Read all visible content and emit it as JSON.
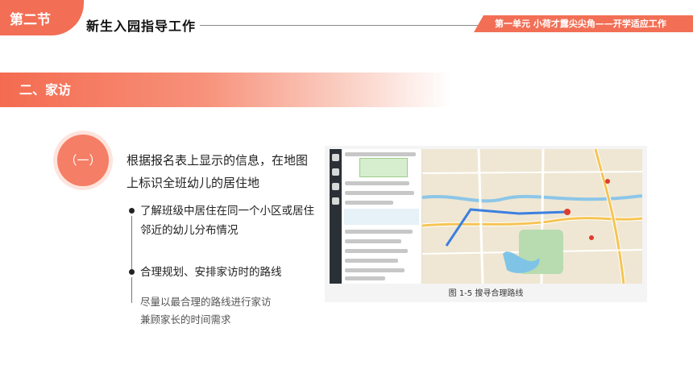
{
  "header": {
    "section_label": "第二节",
    "title": "新生入园指导工作",
    "unit_label": "第一单元  小荷才露尖尖角——开学适应工作"
  },
  "banner": {
    "label": "二、家访"
  },
  "item": {
    "number": "（一）",
    "main_text": "根据报名表上显示的信息，在地图上标识全班幼儿的居住地",
    "points": [
      "了解班级中居住在同一个小区或居住邻近的幼儿分布情况",
      "合理规划、安排家访时的路线"
    ],
    "sub_text": "尽量以最合理的路线进行家访兼顾家长的时间需求"
  },
  "figure": {
    "caption": "图 1-5   搜寻合理路线"
  },
  "colors": {
    "accent": "#f26f55",
    "accent_light": "#fde4dd",
    "text_dark": "#222222"
  }
}
